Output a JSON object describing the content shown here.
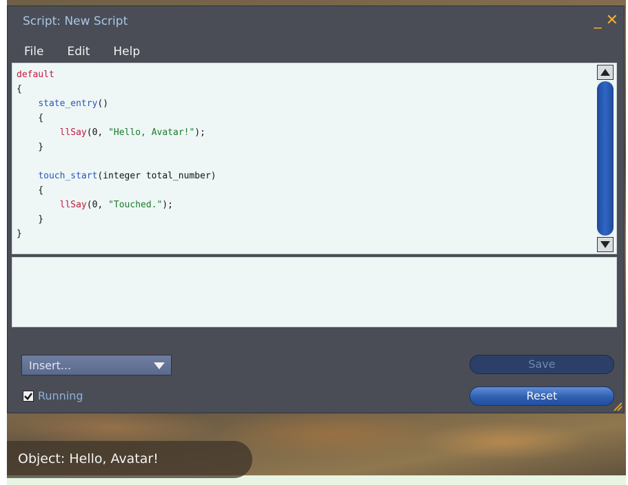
{
  "window": {
    "title": "Script: New Script",
    "minimize_glyph": "_",
    "close_glyph": "✕"
  },
  "menu": {
    "items": [
      "File",
      "Edit",
      "Help"
    ]
  },
  "editor": {
    "lines": [
      [
        {
          "t": "default",
          "c": "kw"
        }
      ],
      [
        {
          "t": "{",
          "c": ""
        }
      ],
      [
        {
          "t": "    ",
          "c": ""
        },
        {
          "t": "state_entry",
          "c": "ev"
        },
        {
          "t": "()",
          "c": ""
        }
      ],
      [
        {
          "t": "    {",
          "c": ""
        }
      ],
      [
        {
          "t": "        ",
          "c": ""
        },
        {
          "t": "llSay",
          "c": "fn"
        },
        {
          "t": "(0, ",
          "c": ""
        },
        {
          "t": "\"Hello, Avatar!\"",
          "c": "str"
        },
        {
          "t": ");",
          "c": ""
        }
      ],
      [
        {
          "t": "    }",
          "c": ""
        }
      ],
      [
        {
          "t": "",
          "c": ""
        }
      ],
      [
        {
          "t": "    ",
          "c": ""
        },
        {
          "t": "touch_start",
          "c": "ev"
        },
        {
          "t": "(integer total_number)",
          "c": ""
        }
      ],
      [
        {
          "t": "    {",
          "c": ""
        }
      ],
      [
        {
          "t": "        ",
          "c": ""
        },
        {
          "t": "llSay",
          "c": "fn"
        },
        {
          "t": "(0, ",
          "c": ""
        },
        {
          "t": "\"Touched.\"",
          "c": "str"
        },
        {
          "t": ");",
          "c": ""
        }
      ],
      [
        {
          "t": "    }",
          "c": ""
        }
      ],
      [
        {
          "t": "}",
          "c": ""
        }
      ]
    ]
  },
  "controls": {
    "insert_label": "Insert...",
    "running_label": "Running",
    "running_checked": true,
    "save_label": "Save",
    "reset_label": "Reset"
  },
  "chat": {
    "message": "Object: Hello, Avatar!"
  },
  "colors": {
    "title_text": "#a9c6e8",
    "window_bg": "#4a4d55",
    "accent_orange": "#f0b030",
    "keyword": "#c0183c",
    "event": "#2b54b8",
    "string": "#1a7a2a"
  }
}
